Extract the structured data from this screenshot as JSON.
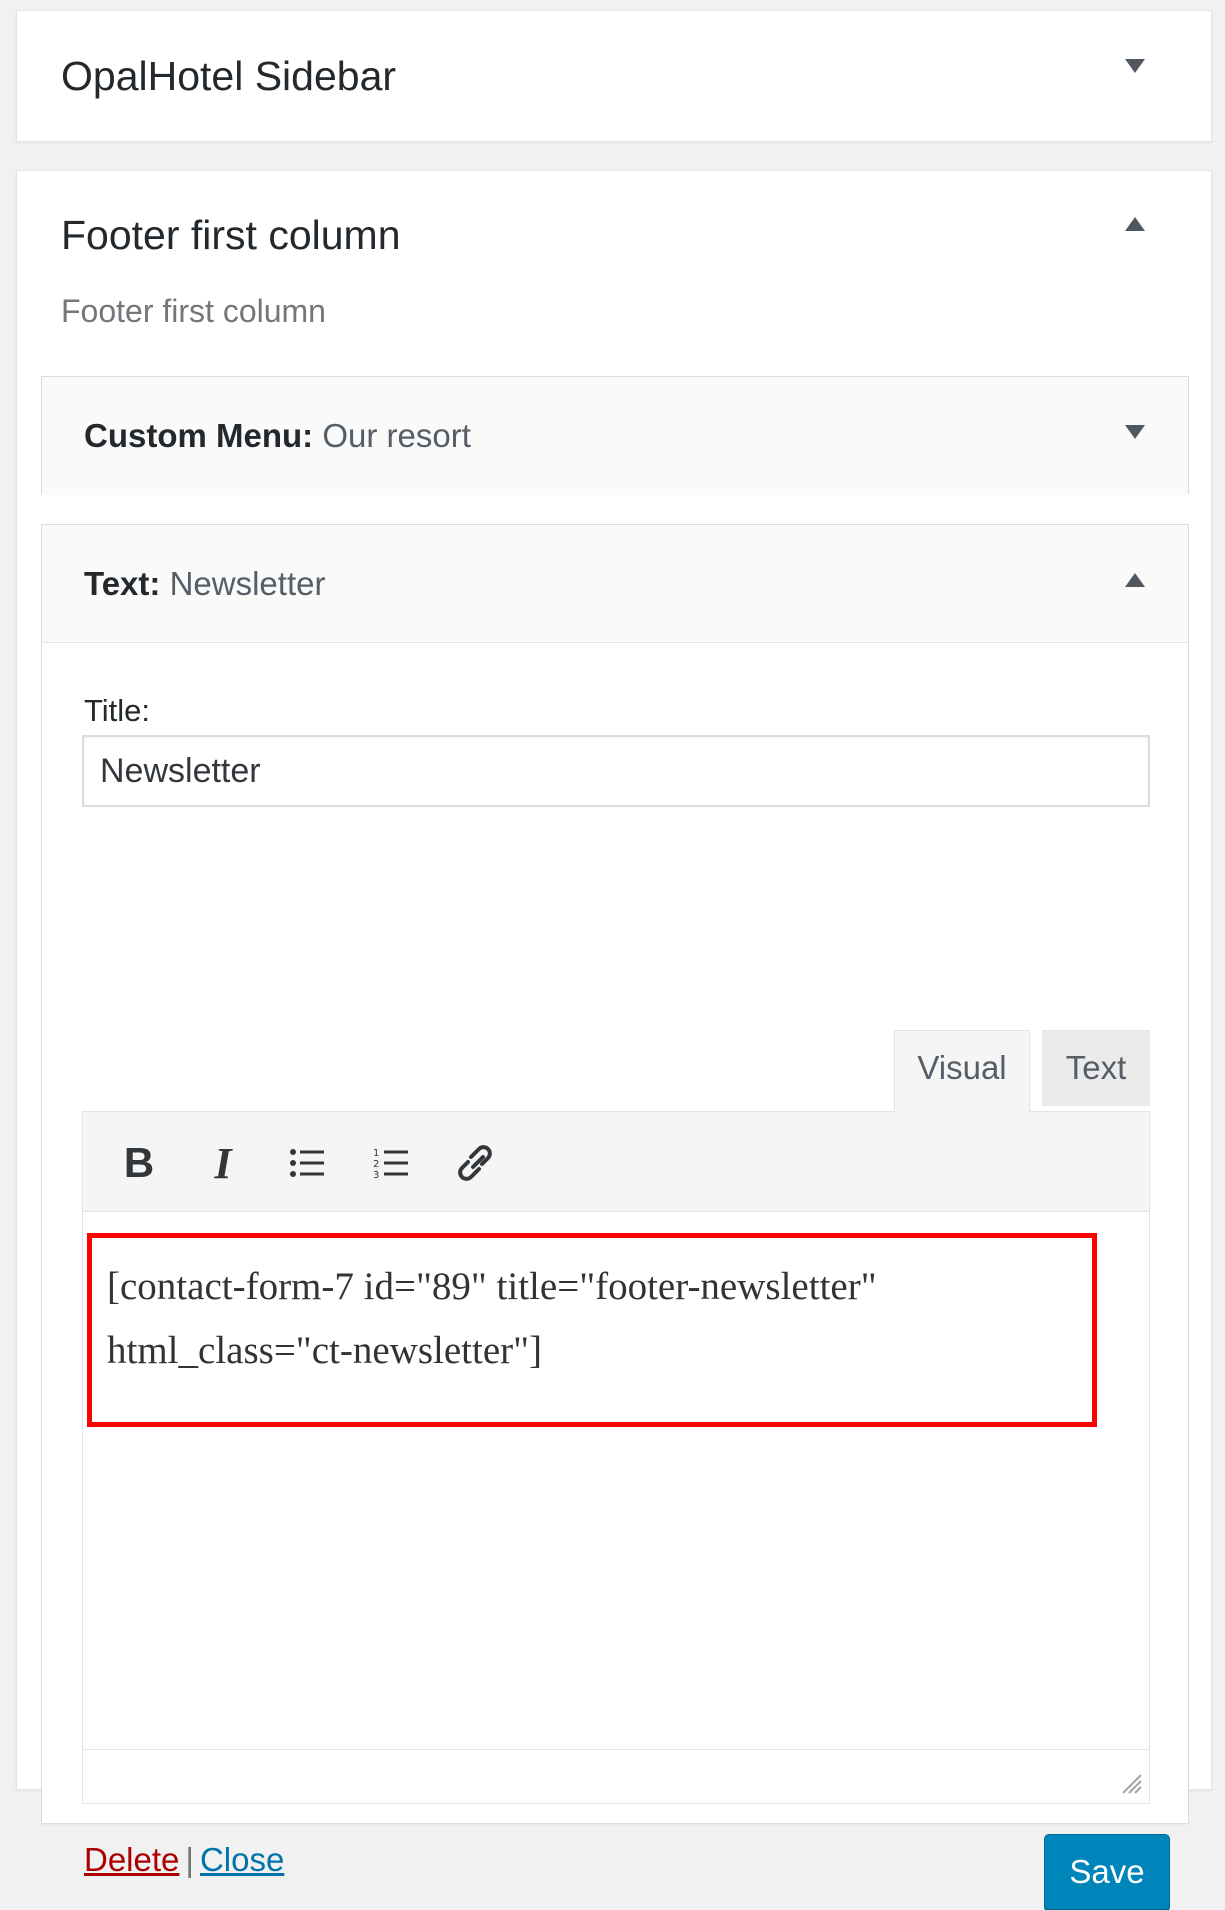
{
  "sidebars": {
    "opal": {
      "title": "OpalHotel Sidebar",
      "toggle_icon": "arrow-down-icon"
    },
    "footer_first": {
      "title": "Footer first column",
      "description": "Footer first column",
      "toggle_icon": "arrow-up-icon"
    }
  },
  "widgets": {
    "custom_menu": {
      "type_label": "Custom Menu:",
      "name": "Our resort",
      "toggle_icon": "arrow-down-icon"
    },
    "text": {
      "type_label": "Text:",
      "name": "Newsletter",
      "toggle_icon": "arrow-up-icon",
      "title_label": "Title:",
      "title_value": "Newsletter",
      "tabs": {
        "visual": "Visual",
        "text": "Text"
      },
      "toolbar": {
        "bold": "B",
        "italic": "I",
        "bullist_icon": "bulleted-list-icon",
        "numlist_icon": "numbered-list-icon",
        "link_icon": "link-icon"
      },
      "content": "[contact-form-7 id=\"89\" title=\"footer-newsletter\" html_class=\"ct-newsletter\"]",
      "highlight_color": "#ff0000",
      "actions": {
        "delete": "Delete",
        "separator": "|",
        "close": "Close",
        "save": "Save"
      }
    }
  },
  "colors": {
    "primary_button": "#0085ba",
    "delete_link": "#aa0000",
    "close_link": "#0073aa"
  }
}
